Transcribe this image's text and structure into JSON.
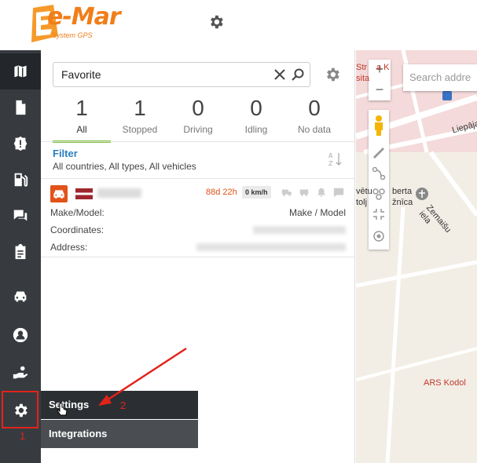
{
  "header": {
    "logo_text": "e-Mar",
    "logo_sub": "System GPS"
  },
  "sidebar": {
    "items": [
      {
        "name": "map",
        "icon": "map-icon"
      },
      {
        "name": "documents",
        "icon": "document-icon"
      },
      {
        "name": "alerts",
        "icon": "alert-icon"
      },
      {
        "name": "fuel",
        "icon": "fuel-icon"
      },
      {
        "name": "messages",
        "icon": "chat-icon"
      },
      {
        "name": "reports",
        "icon": "clipboard-icon"
      },
      {
        "name": "vehicles",
        "icon": "car-icon"
      },
      {
        "name": "account",
        "icon": "user-icon"
      },
      {
        "name": "services",
        "icon": "hand-icon"
      },
      {
        "name": "settings",
        "icon": "gear-icon"
      }
    ],
    "marker_1": "1"
  },
  "search": {
    "value": "Favorite",
    "placeholder": ""
  },
  "status_tabs": [
    {
      "count": "1",
      "label": "All",
      "active": true
    },
    {
      "count": "1",
      "label": "Stopped",
      "active": false
    },
    {
      "count": "0",
      "label": "Driving",
      "active": false
    },
    {
      "count": "0",
      "label": "Idling",
      "active": false
    },
    {
      "count": "0",
      "label": "No data",
      "active": false
    }
  ],
  "filter": {
    "title": "Filter",
    "description": "All countries, All types, All vehicles"
  },
  "vehicle": {
    "duration": "88d 22h",
    "speed": "0 km/h",
    "make_model_label": "Make/Model:",
    "make_model_value": "Make / Model",
    "coordinates_label": "Coordinates:",
    "address_label": "Address:"
  },
  "submenu": {
    "settings": "Settings",
    "integrations": "Integrations",
    "marker_2": "2"
  },
  "map": {
    "search_placeholder": "Search addre",
    "zoom_in": "+",
    "zoom_out": "−",
    "labels": {
      "top": "Str",
      "top2": "a K",
      "sita": "sita",
      "liepaja": "Liepāja",
      "vetu": "vētu",
      "berta": "berta",
      "tolj": "tolj",
      "zmica": "žnīca",
      "zemaisu": "Zemaišu iela",
      "ars": "ARS Kodol"
    }
  }
}
